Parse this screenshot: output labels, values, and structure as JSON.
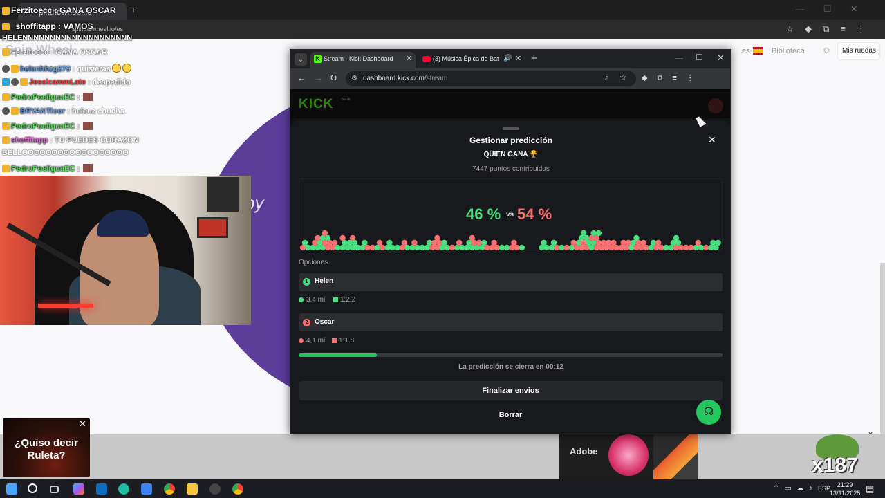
{
  "background_browser": {
    "tab_title": "pinthewheel.io",
    "url": "spinthewheel.io/es",
    "page_title": "Spin Wheel",
    "wheel_text": "py",
    "lang_code": "es",
    "library_label": "Biblioteca",
    "my_wheels_button": "Mis ruedas"
  },
  "chat": {
    "lines": [
      {
        "user": "Ferzitoecc",
        "sep": " : ",
        "text": "GANA OSCAR"
      },
      {
        "user": "_shoffitapp",
        "sep": " : ",
        "text": "VAMOS"
      },
      {
        "user": "",
        "sep": "",
        "text": "HELENNNNNNNNNNNNNNNNNNNN"
      },
      {
        "user": "Ferzitoecc",
        "sep": " : ",
        "text": "GANA OSCAR"
      },
      {
        "user": "helenhhzg279",
        "sep": " : ",
        "text": "quisieras"
      },
      {
        "user": "JessicammLate",
        "sep": " : ",
        "text": "despedido"
      },
      {
        "user": "PedroPosliguaEC",
        "sep": " : ",
        "text": ""
      },
      {
        "user": "BRYANTloor",
        "sep": " : ",
        "text": "helenz chucha"
      },
      {
        "user": "PedroPosliguaEC",
        "sep": " : ",
        "text": ""
      },
      {
        "user": "shoffitapp",
        "sep": " : ",
        "text": "TU PUEDES CORAZON"
      },
      {
        "user": "",
        "sep": "",
        "text": "BELLOOOOOOOOOOOOOOOOOO"
      },
      {
        "user": "PedroPosliguaEC",
        "sep": " : ",
        "text": ""
      }
    ]
  },
  "ads": {
    "ruleta_text": "¿Quiso decir Ruleta?",
    "close_glyph": "✕",
    "adobe_label": "Adobe",
    "overlay_text": "x187"
  },
  "window": {
    "tab1_title": "Stream - Kick Dashboard",
    "tab2_title": "(3) Música Épica de Batalla",
    "url_host": "dashboard.kick.com",
    "url_path": "/stream",
    "logo": "KICK",
    "logo_badge": "BETA"
  },
  "prediction": {
    "heading": "Gestionar predicción",
    "question": "QUIEN GANA 🏆",
    "points": "7447 puntos contribuidos",
    "pct_left": "46 %",
    "vs": "vs",
    "pct_right": "54 %",
    "options_heading": "Opciones",
    "options": [
      {
        "num": "1",
        "name": "Helen",
        "amount": "3,4 mil",
        "ratio": "1:2.2",
        "color": "#4ade80"
      },
      {
        "num": "2",
        "name": "Oscar",
        "amount": "4,1 mil",
        "ratio": "1:1.8",
        "color": "#f87171"
      }
    ],
    "progress_fraction": 0.185,
    "closes_text": "La predicción se cierra en 00:12",
    "finalize_button": "Finalizar envios",
    "delete_button": "Borrar"
  },
  "taskbar": {
    "lang": "ESP",
    "time": "21:29",
    "date": "13/11/2025"
  },
  "colors": {
    "kick_green": "#53fc18",
    "helen_green": "#4ade80",
    "oscar_red": "#f87171",
    "progress": "#22c55e"
  }
}
